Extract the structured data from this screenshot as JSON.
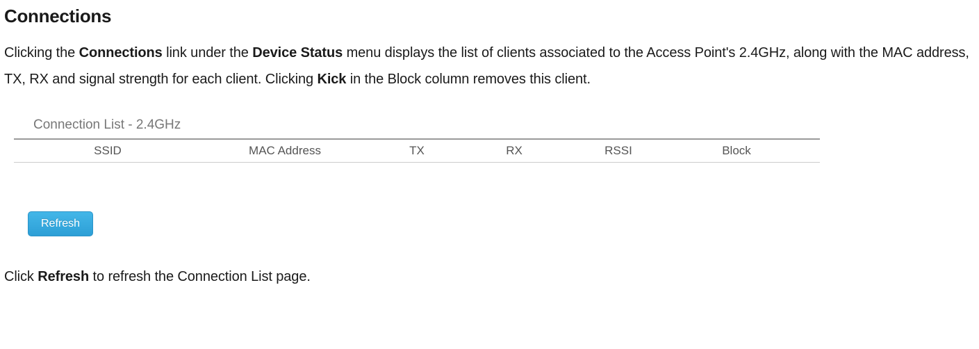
{
  "title": "Connections",
  "description": {
    "pre1": "Clicking the ",
    "bold1": "Connections",
    "mid1": " link under the ",
    "bold2": "Device Status",
    "mid2": " menu displays the list of clients associated to the Access Point's 2.4GHz, along with the MAC address, TX, RX and signal strength for each client. Clicking ",
    "bold3": "Kick",
    "post1": " in the Block column removes this client."
  },
  "panel_title": "Connection List - 2.4GHz",
  "columns": {
    "ssid": "SSID",
    "mac": "MAC Address",
    "tx": "TX",
    "rx": "RX",
    "rssi": "RSSI",
    "block": "Block"
  },
  "refresh_button": "Refresh",
  "footer": {
    "pre": "Click ",
    "bold": "Refresh",
    "post": " to refresh the Connection List page."
  }
}
